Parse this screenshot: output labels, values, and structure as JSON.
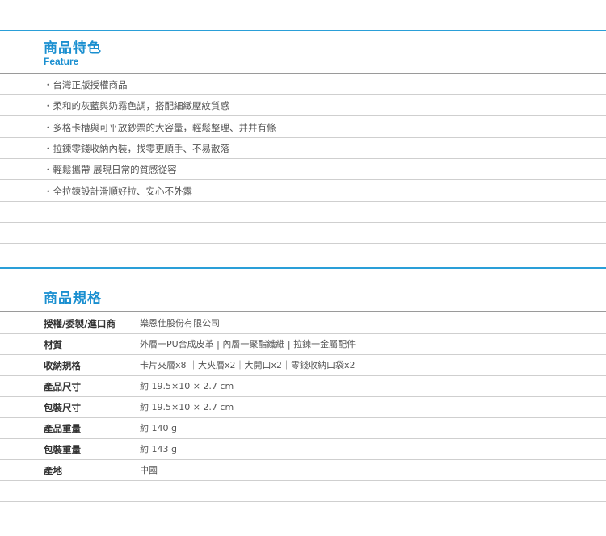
{
  "features": {
    "title": "商品特色",
    "subtitle": "Feature",
    "items": [
      "・台灣正版授權商品",
      "・柔和的灰藍與奶霧色調，搭配細緻壓紋質感",
      "・多格卡槽與可平放鈔票的大容量，輕鬆整理、井井有條",
      "・拉鍊零錢收納內裝，找零更順手、不易散落",
      "・輕鬆攜帶 展現日常的質感從容",
      "・全拉鍊設計滑順好拉、安心不外露"
    ]
  },
  "specs": {
    "title": "商品規格",
    "rows": [
      {
        "label": "授權/委製/進口商",
        "value": "樂恩仕股份有限公司"
      },
      {
        "label": "材質",
        "value": "外層一PU合成皮革 | 內層一聚酯纖維 | 拉鍊一金屬配件"
      },
      {
        "label": "收納規格",
        "value": "卡片夾層x8 ｜大夾層x2｜大開口x2｜零錢收納口袋x2"
      },
      {
        "label": "產品尺寸",
        "value": "約 19.5×10 × 2.7 cm"
      },
      {
        "label": "包裝尺寸",
        "value": "約 19.5×10 × 2.7 cm"
      },
      {
        "label": "產品重量",
        "value": "約 140 g"
      },
      {
        "label": "包裝重量",
        "value": "約 143 g"
      },
      {
        "label": "產地",
        "value": "中國"
      }
    ]
  }
}
